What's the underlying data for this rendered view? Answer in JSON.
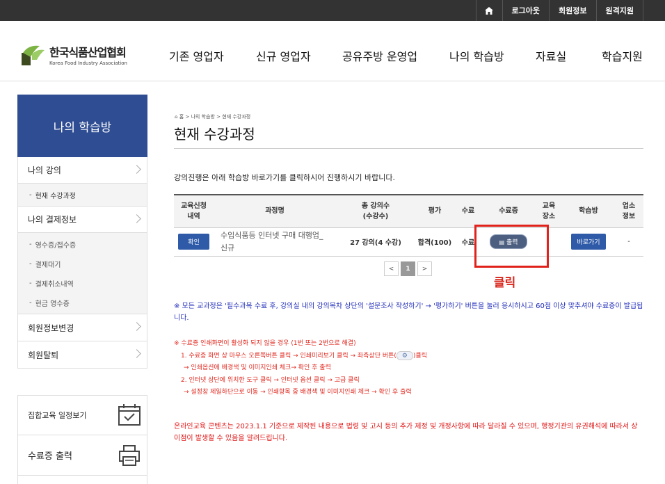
{
  "topbar": {
    "home_icon": "home-icon",
    "logout": "로그아웃",
    "member_info": "회원정보",
    "remote_support": "원격지원"
  },
  "logo": {
    "name_ko": "한국식품산업협회",
    "name_en": "Korea Food Industry Association",
    "colors": {
      "green": "#7cb342",
      "dark": "#3d4a1f"
    }
  },
  "nav": [
    "기존 영업자",
    "신규 영업자",
    "공유주방 운영업",
    "나의 학습방",
    "자료실",
    "학습지원"
  ],
  "sidebar": {
    "title": "나의 학습방",
    "items": [
      {
        "label": "나의 강의",
        "sub": [
          "현재 수강과정"
        ]
      },
      {
        "label": "나의 결제정보",
        "sub": [
          "영수증/접수증",
          "결제대기",
          "결제취소내역",
          "현금 영수증"
        ]
      },
      {
        "label": "회원정보변경",
        "sub": []
      },
      {
        "label": "회원탈퇴",
        "sub": []
      }
    ],
    "boxes": [
      {
        "label": "집합교육 일정보기",
        "icon": "calendar-check-icon"
      },
      {
        "label": "수료증 출력",
        "icon": "printer-icon"
      }
    ]
  },
  "breadcrumb": [
    "홈",
    "나의 학습방",
    "현재 수강과정"
  ],
  "page_title": "현재 수강과정",
  "intro": "강의진행은 아래 학습방 바로가기를 클릭하시어 진행하시기 바랍니다.",
  "table": {
    "headers": [
      "교육신청\n내역",
      "과정명",
      "총 강의수\n(수강수)",
      "평가",
      "수료",
      "수료증",
      "교육\n장소",
      "학습방",
      "업소\n정보"
    ],
    "rows": [
      {
        "apply": "확인",
        "course": "수입식품등 인터넷 구매 대행업_\n신규",
        "lectures": "27 강의(4 수강)",
        "eval": "합격(100)",
        "complete": "수료",
        "cert": "출력",
        "place": "",
        "room": "바로가기",
        "shop": "-"
      }
    ]
  },
  "pager": {
    "prev": "<",
    "current": "1",
    "next": ">"
  },
  "click_label": "클릭",
  "notice1": "※ 모든 교과정은 '필수과목 수료 후, 강의실 내의 강의목차 상단의 '설문조사 작성하기' → '평가하기' 버튼을 눌러 응시하시고 60점 이상 맞추셔야 수료증이 발급됩니다.",
  "notice2": {
    "title": "※ 수료증 인쇄화면이 활성화 되지 않을 경우 (1번 또는 2번으로 해결)",
    "l1": "1. 수료증 화면 상 마우스 오른쪽버튼 클릭 → 인쇄미리보기 클릭 → 좌측상단 버튼(",
    "l1b": ")클릭",
    "l2": "→ 인쇄옵션에 배경색 및 이미지인쇄 체크→ 확인 후 출력",
    "l3": "2. 인터넷 상단에 위치한 도구 클릭 → 인터넷 옵션 클릭 → 고급 클릭",
    "l4": "→ 설정창 제일하단으로 이동 → 인쇄항목 중 배경색 및 이미지인쇄 체크 → 확인 후 출력"
  },
  "notice3": "온라인교육 콘텐츠는 2023.1.1 기준으로 제작된 내용으로 법령 및 고시 등의 추가 제정 및 개정사항에 따라 달라질 수 있으며, 행정기관의 유권해석에 따라서 상이점이 발생할 수 있음을 알려드립니다."
}
